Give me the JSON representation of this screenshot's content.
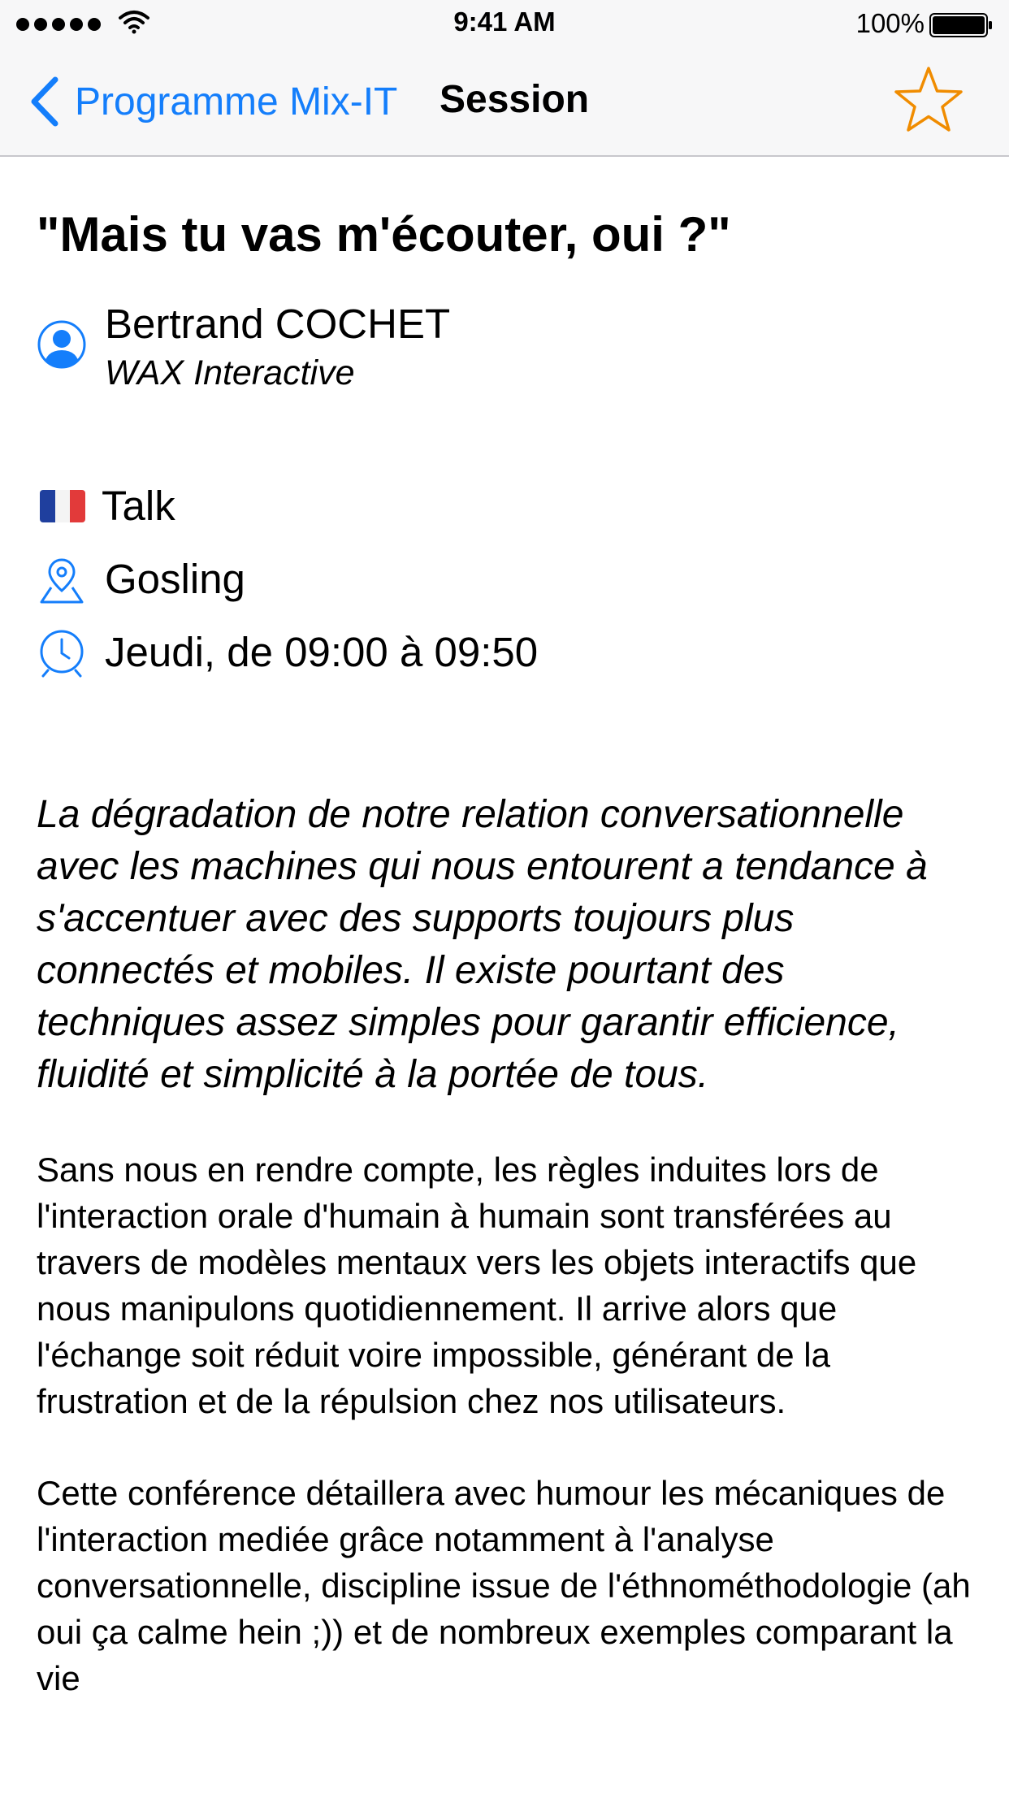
{
  "status_bar": {
    "time": "9:41 AM",
    "battery_pct": "100%"
  },
  "nav": {
    "back_label": "Programme Mix-IT",
    "title": "Session",
    "accent_color": "#147efb",
    "star_color": "#f08c00"
  },
  "session": {
    "title": "\"Mais tu vas m'écouter, oui ?\"",
    "speaker_name": "Bertrand COCHET",
    "speaker_company": "WAX Interactive",
    "format": "Talk",
    "language_flag": "france-flag",
    "room": "Gosling",
    "time": "Jeudi, de 09:00 à 09:50",
    "summary": "La dégradation de notre relation conversationnelle avec les machines qui nous entourent a tendance à s'accentuer avec des supports toujours plus connectés et mobiles. Il existe pourtant des techniques assez simples pour garantir efficience, fluidité et simplicité à la portée de tous.",
    "paragraphs": [
      "Sans nous en rendre compte, les règles induites lors de l'interaction orale d'humain à humain sont transférées au travers de modèles mentaux vers les objets interactifs que nous manipulons quotidiennement. Il arrive alors que l'échange soit réduit voire impossible, générant de la frustration et de la répulsion chez nos utilisateurs.",
      "Cette conférence détaillera avec humour les mécaniques de l'interaction mediée grâce notamment à l'analyse conversationnelle, discipline issue de l'éthnométhodologie (ah oui ça calme hein ;)) et de nombreux exemples comparant la vie"
    ]
  }
}
